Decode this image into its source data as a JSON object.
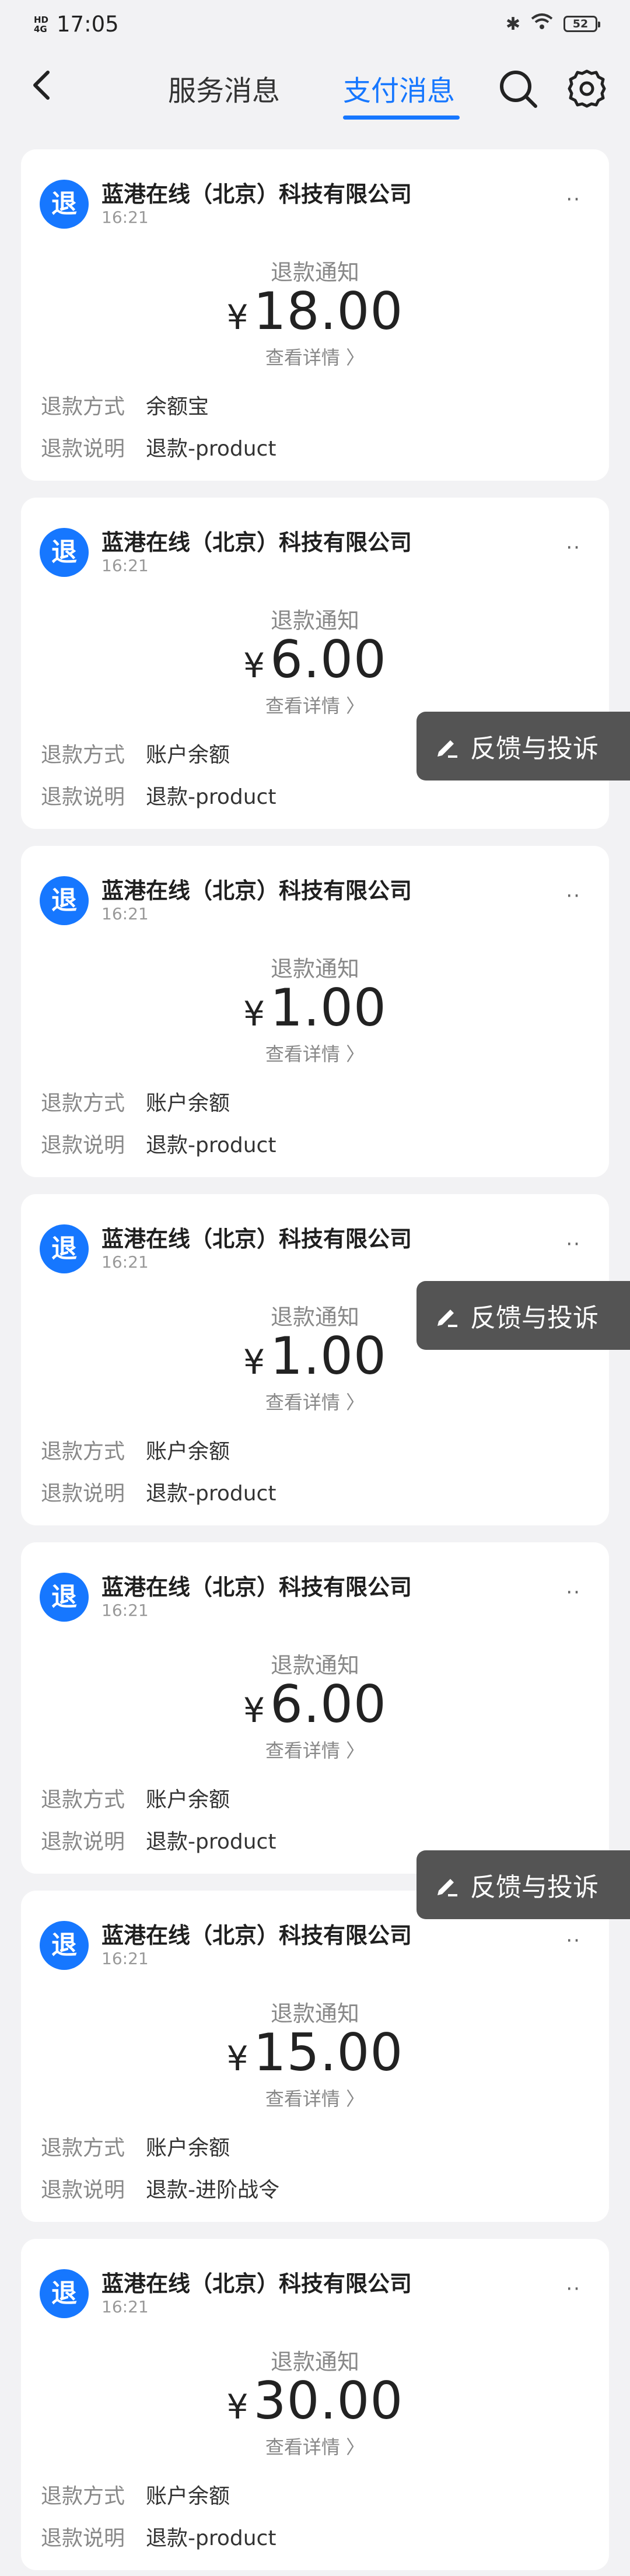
{
  "status_bar": {
    "network": "4G",
    "network_sub": "HD",
    "time": "17:05",
    "battery": "52"
  },
  "header": {
    "tab_service": "服务消息",
    "tab_pay": "支付消息"
  },
  "labels": {
    "refund_method": "退款方式",
    "refund_note": "退款说明",
    "view_detail": "查看详情 〉",
    "badge": "退",
    "notice": "退款通知",
    "currency": "¥",
    "more": "··"
  },
  "feedback_label": "反馈与投诉",
  "cards": [
    {
      "merchant": "蓝港在线（北京）科技有限公司",
      "time": "16:21",
      "amount": "18.00",
      "method": "余额宝",
      "note": "退款-product"
    },
    {
      "merchant": "蓝港在线（北京）科技有限公司",
      "time": "16:21",
      "amount": "6.00",
      "method": "账户余额",
      "note": "退款-product"
    },
    {
      "merchant": "蓝港在线（北京）科技有限公司",
      "time": "16:21",
      "amount": "1.00",
      "method": "账户余额",
      "note": "退款-product"
    },
    {
      "merchant": "蓝港在线（北京）科技有限公司",
      "time": "16:21",
      "amount": "1.00",
      "method": "账户余额",
      "note": "退款-product"
    },
    {
      "merchant": "蓝港在线（北京）科技有限公司",
      "time": "16:21",
      "amount": "6.00",
      "method": "账户余额",
      "note": "退款-product"
    },
    {
      "merchant": "蓝港在线（北京）科技有限公司",
      "time": "16:21",
      "amount": "15.00",
      "method": "账户余额",
      "note": "退款-进阶战令"
    },
    {
      "merchant": "蓝港在线（北京）科技有限公司",
      "time": "16:21",
      "amount": "30.00",
      "method": "账户余额",
      "note": "退款-product"
    }
  ]
}
